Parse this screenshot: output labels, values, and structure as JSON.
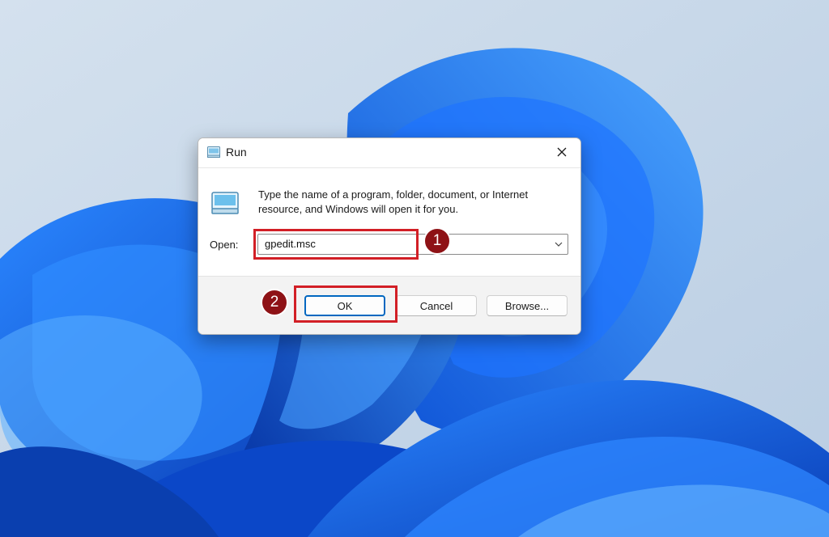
{
  "dialog": {
    "title": "Run",
    "description": "Type the name of a program, folder, document, or Internet resource, and Windows will open it for you.",
    "open_label": "Open:",
    "open_value": "gpedit.msc",
    "buttons": {
      "ok": "OK",
      "cancel": "Cancel",
      "browse": "Browse..."
    },
    "icons": {
      "title": "run-icon",
      "app": "run-icon",
      "close": "close-icon",
      "dropdown": "chevron-down-icon"
    }
  },
  "annotations": {
    "step1": "1",
    "step2": "2",
    "highlight_color": "#d21f26",
    "marker_color": "#8e1216"
  },
  "colors": {
    "wallpaper_bg": "#c9d9ea",
    "wallpaper_bloom": "#0a5ce8",
    "ok_border": "#0067c0"
  }
}
